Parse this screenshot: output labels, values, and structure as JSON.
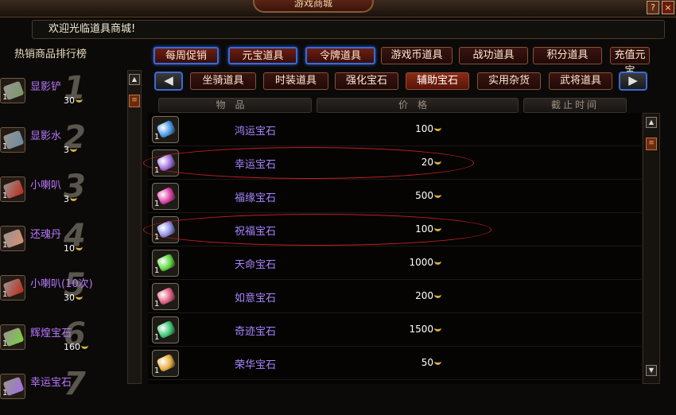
{
  "window": {
    "title": "游戏商城",
    "help": "?",
    "close": "×"
  },
  "welcome": "欢迎光临道具商城!",
  "sidebar": {
    "title": "热销商品排行榜",
    "items": [
      {
        "rank": "1",
        "name": "显影铲",
        "qty": "1",
        "price": "30",
        "color": "#7a9a6a"
      },
      {
        "rank": "2",
        "name": "显影水",
        "qty": "1",
        "price": "3",
        "color": "#6a8aa0"
      },
      {
        "rank": "3",
        "name": "小喇叭",
        "qty": "1",
        "price": "3",
        "color": "#c02818"
      },
      {
        "rank": "4",
        "name": "还魂丹",
        "qty": "1",
        "price": "10",
        "color": "#d89070"
      },
      {
        "rank": "5",
        "name": "小喇叭(10次)",
        "qty": "1",
        "price": "30",
        "color": "#c02818"
      },
      {
        "rank": "6",
        "name": "辉煌宝石",
        "qty": "1",
        "price": "160",
        "color": "#7ad040"
      },
      {
        "rank": "7",
        "name": "幸运宝石",
        "qty": "1",
        "price": "",
        "color": "#a070e0"
      }
    ]
  },
  "tabs_row1": [
    {
      "label": "每周促销",
      "active": true
    },
    {
      "label": "元宝道具",
      "active": true
    },
    {
      "label": "令牌道具",
      "active": true
    },
    {
      "label": "游戏币道具",
      "active": false
    },
    {
      "label": "战功道具",
      "active": false
    },
    {
      "label": "积分道具",
      "active": false
    },
    {
      "label": "充值元宝",
      "active": false
    }
  ],
  "tabs_row2": [
    {
      "label": "坐骑道具",
      "active": false
    },
    {
      "label": "时装道具",
      "active": false
    },
    {
      "label": "强化宝石",
      "active": false
    },
    {
      "label": "辅助宝石",
      "active": false,
      "highlight": true
    },
    {
      "label": "实用杂货",
      "active": false
    },
    {
      "label": "武将道具",
      "active": false
    }
  ],
  "nav": {
    "prev": "◀",
    "next": "▶"
  },
  "columns": {
    "item": "物品",
    "price": "价格",
    "deadline": "截止时间"
  },
  "items": [
    {
      "name": "鸿运宝石",
      "qty": "1",
      "price": "100",
      "color": "#4a9ae8",
      "circled": false
    },
    {
      "name": "幸运宝石",
      "qty": "1",
      "price": "20",
      "color": "#a070e0",
      "circled": true
    },
    {
      "name": "福缘宝石",
      "qty": "1",
      "price": "500",
      "color": "#e040a8",
      "circled": false
    },
    {
      "name": "祝福宝石",
      "qty": "1",
      "price": "100",
      "color": "#9090e8",
      "circled": true
    },
    {
      "name": "天命宝石",
      "qty": "1",
      "price": "1000",
      "color": "#60d840",
      "circled": false
    },
    {
      "name": "如意宝石",
      "qty": "1",
      "price": "200",
      "color": "#e06080",
      "circled": false
    },
    {
      "name": "奇迹宝石",
      "qty": "1",
      "price": "1500",
      "color": "#40c878",
      "circled": false
    },
    {
      "name": "荣华宝石",
      "qty": "1",
      "price": "50",
      "color": "#e8b040",
      "circled": false
    }
  ],
  "colors": {
    "accent_blue": "#3a6ad8",
    "name_purple": "#a884ff",
    "annotation_red": "#c02020"
  }
}
